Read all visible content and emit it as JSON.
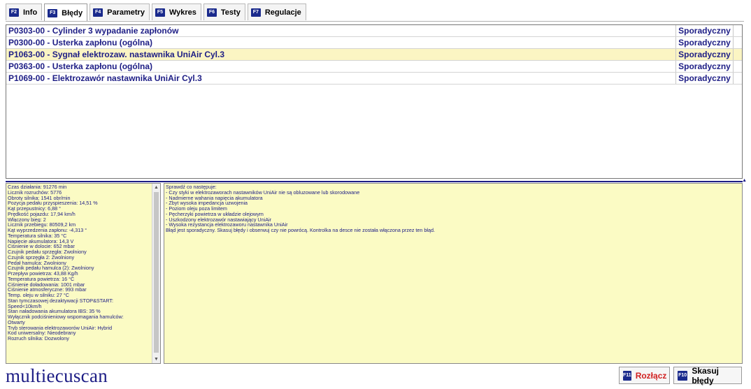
{
  "tabs": [
    {
      "key": "F2",
      "label": "Info",
      "active": false
    },
    {
      "key": "F3",
      "label": "Błędy",
      "active": true
    },
    {
      "key": "F4",
      "label": "Parametry",
      "active": false
    },
    {
      "key": "F5",
      "label": "Wykres",
      "active": false
    },
    {
      "key": "F6",
      "label": "Testy",
      "active": false
    },
    {
      "key": "F7",
      "label": "Regulacje",
      "active": false
    }
  ],
  "errors": [
    {
      "code": "P0303-00 - Cylinder 3 wypadanie zapłonów",
      "status": "Sporadyczny",
      "selected": false
    },
    {
      "code": "P0300-00 - Usterka zapłonu (ogólna)",
      "status": "Sporadyczny",
      "selected": false
    },
    {
      "code": "P1063-00 - Sygnał elektrozaw. nastawnika UniAir Cyl.3",
      "status": "Sporadyczny",
      "selected": true
    },
    {
      "code": "P0363-00 - Usterka zapłonu (ogólna)",
      "status": "Sporadyczny",
      "selected": false
    },
    {
      "code": "P1069-00 - Elektrozawór nastawnika UniAir Cyl.3",
      "status": "Sporadyczny",
      "selected": false
    }
  ],
  "freeze_frame": [
    "Czas działania: 91276 min",
    "Licznik rozruchów: 5776",
    "Obroty silnika: 1541 obr/min",
    "Pozycja pedału przyspieszenia: 14,51 %",
    "Kąt przepustnicy: 6,88 °",
    "Prędkość pojazdu: 17,94 km/h",
    "Włączony bieg: 2",
    "Licznik przebiegu: 80509,2 km",
    "Kąt wyprzedzenia zapłonu: -4,313 °",
    "Temperatura silnika: 35 °C",
    "Napięcie akumulatora: 14,3 V",
    "Ciśnienie w dolocie: 652 mbar",
    "Czujnik pedału sprzęgła: Zwolniony",
    "Czujnik sprzęgła 2: Zwolniony",
    "Pedał hamulca: Zwolniony",
    "Czujnik pedału hamulca (2): Zwolniony",
    "Przepływ powietrza: 43,88 Kg/h",
    "Temperatura powietrza: 16 °C",
    "Ciśnienie doładowania: 1001 mbar",
    "Ciśnienie atmosferyczne: 993 mbar",
    "Temp. oleju w silniku: 27 °C",
    "Stan tymczasowej dezaktywacji STOP&START:",
    "Speed<10km/h",
    "Stan naładowania akumulatora IBS: 35 %",
    "Wyłącznik podciśnieniowy wspomagania hamulców:",
    "Otwarty",
    "Tryb sterowania elektrozaworów UniAir: Hybrid",
    "Kod uniwersalny: Nieodebrany",
    "Rozruch silnika: Dozwolony"
  ],
  "notes": [
    "Sprawdź co następuje:",
    "- Czy styki w elektrozaworach nastawników UniAir nie są obluzowane lub skorodowane",
    "- Nadmierne wahania napięcia akumulatora",
    "- Zbyt wysoka impedancja uzwojenia",
    "- Poziom oleju poza limitem",
    "- Pęcherzyki powietrza w układzie olejowym",
    "- Uszkodzony elektrozawór nastawiający UniAir",
    "- Wysoka rezystancja elektrozaworu nastawnika UniAir",
    "Błąd jest sporadyczny. Skasuj błędy i obserwuj czy nie powrócą. Kontrolka na desce nie została włączona przez ten błąd."
  ],
  "footer": {
    "logo": "multiecuscan",
    "disconnect_key": "F11",
    "disconnect_label": "Rozłącz",
    "clear_key": "F10",
    "clear_label": "Skasuj błędy"
  },
  "colors": {
    "accent": "#1d1d85",
    "selected_row": "#fbf5c3",
    "pane_bg": "#fbfbc4",
    "disconnect": "#d02020"
  }
}
